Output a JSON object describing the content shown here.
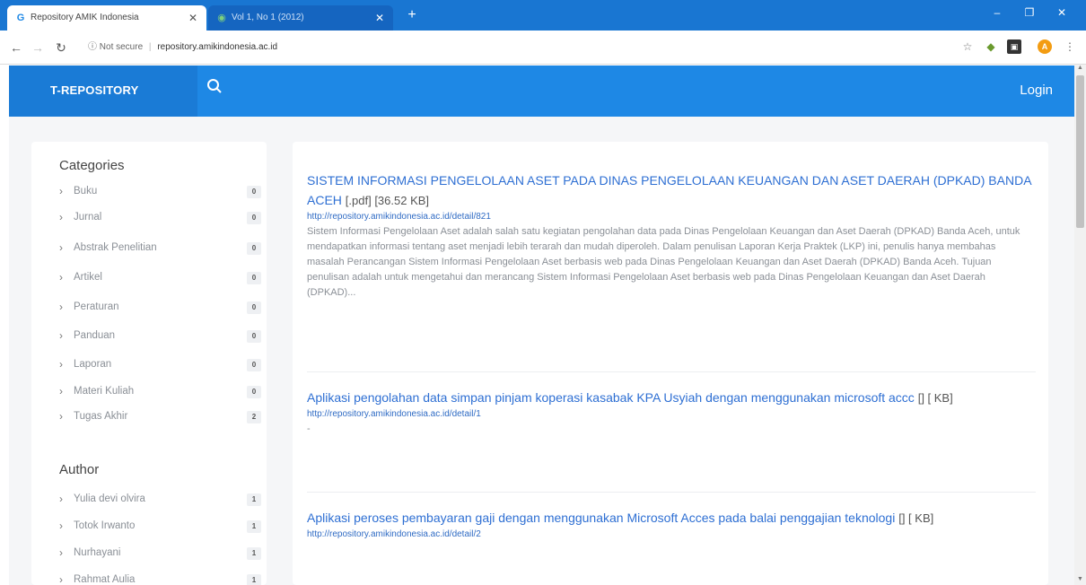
{
  "browser": {
    "tabs": [
      {
        "title": "Repository AMIK Indonesia",
        "active": true
      },
      {
        "title": "Vol 1, No 1 (2012)",
        "active": false
      }
    ],
    "security_label": "Not secure",
    "url": "repository.amikindonesia.ac.id",
    "new_tab": "+",
    "window_min": "–",
    "window_max": "❐",
    "window_close": "✕",
    "profile_initial": "A"
  },
  "header": {
    "brand": "T-REPOSITORY",
    "login": "Login"
  },
  "sidebar": {
    "categories_heading": "Categories",
    "categories": [
      {
        "label": "Buku",
        "count": "0"
      },
      {
        "label": "Jurnal",
        "count": "0"
      },
      {
        "label": "Abstrak Penelitian",
        "count": "0"
      },
      {
        "label": "Artikel",
        "count": "0"
      },
      {
        "label": "Peraturan",
        "count": "0"
      },
      {
        "label": "Panduan",
        "count": "0"
      },
      {
        "label": "Laporan",
        "count": "0"
      },
      {
        "label": "Materi Kuliah",
        "count": "0"
      },
      {
        "label": "Tugas Akhir",
        "count": "2"
      }
    ],
    "author_heading": "Author",
    "authors": [
      {
        "label": "Yulia devi olvira",
        "count": "1"
      },
      {
        "label": "Totok Irwanto",
        "count": "1"
      },
      {
        "label": "Nurhayani",
        "count": "1"
      },
      {
        "label": "Rahmat Aulia",
        "count": "1"
      }
    ]
  },
  "entries": [
    {
      "title": "SISTEM INFORMASI PENGELOLAAN ASET PADA DINAS PENGELOLAAN KEUANGAN DAN ASET DAERAH (DPKAD) BANDA ACEH",
      "meta": "[.pdf] [36.52 KB]",
      "url": "http://repository.amikindonesia.ac.id/detail/821",
      "description": "Sistem Informasi Pengelolaan Aset adalah salah satu kegiatan pengolahan data pada Dinas Pengelolaan Keuangan dan Aset Daerah (DPKAD) Banda Aceh, untuk mendapatkan informasi tentang aset menjadi lebih terarah dan mudah diperoleh. Dalam penulisan Laporan Kerja Praktek (LKP) ini, penulis hanya membahas masalah Perancangan Sistem Informasi Pengelolaan Aset berbasis web pada Dinas Pengelolaan Keuangan dan Aset Daerah (DPKAD) Banda Aceh. Tujuan penulisan adalah untuk mengetahui dan merancang Sistem Informasi Pengelolaan Aset berbasis web pada Dinas Pengelolaan Keuangan dan Aset Daerah (DPKAD)..."
    },
    {
      "title": "Aplikasi pengolahan data simpan pinjam koperasi kasabak KPA Usyiah dengan menggunakan microsoft accc",
      "meta": "[] [ KB]",
      "url": "http://repository.amikindonesia.ac.id/detail/1",
      "description": "-"
    },
    {
      "title": "Aplikasi peroses pembayaran gaji dengan menggunakan Microsoft Acces pada balai penggajian teknologi",
      "meta": "[] [ KB]",
      "url": "http://repository.amikindonesia.ac.id/detail/2",
      "description": ""
    }
  ]
}
